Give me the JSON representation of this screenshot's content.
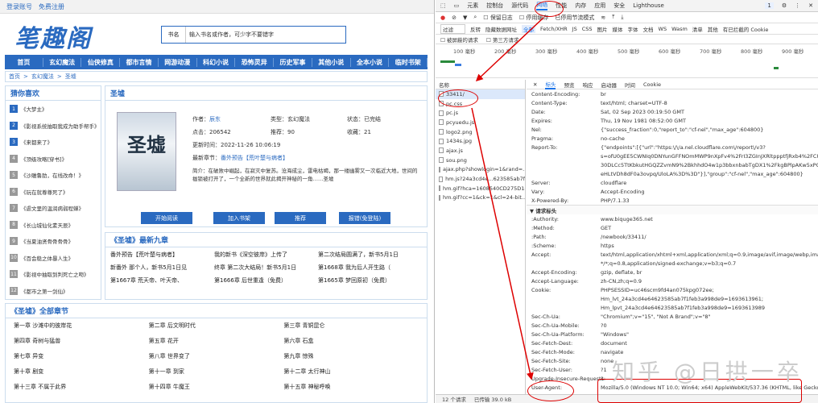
{
  "site": {
    "topbar": {
      "login": "登录账号",
      "register": "免费注册"
    },
    "logo": "笔趣阁",
    "search": {
      "select": "书名",
      "placeholder": "输入书名或作者，可少字不要错字"
    },
    "nav": [
      "首页",
      "玄幻魔法",
      "仙侠修真",
      "都市言情",
      "网游动漫",
      "科幻小说",
      "恐怖灵异",
      "历史军事",
      "其他小说",
      "全本小说",
      "临时书架"
    ],
    "breadcrumb": [
      "首页",
      "玄幻魔法",
      "圣墟"
    ],
    "rec_title": "猜你喜欢",
    "rec_items": [
      "《大梦主》",
      "《影视系统抽取我成为助手帮手》",
      "《来都来了》",
      "《顶级攻略[穿书]》",
      "《沙雕鲁肋，在线改命！》",
      "《玩在就尊尊死了》",
      "《虐文里的温润病弱程蝉》",
      "《长山城仙化素天辰》",
      "《当夏油贤骨骨骨骨》",
      "《百会稳之体暴人生》",
      "《影视中抽取到判死亡之吻》",
      "《都市之第一剑仙》"
    ],
    "book": {
      "title": "圣墟",
      "cover_title": "圣墟",
      "author_label": "作者：",
      "author": "辰东",
      "type_label": "类型：",
      "type": "玄幻魔法",
      "status_label": "状态：",
      "status": "已完结",
      "clicks_label": "点击：",
      "clicks": "206542",
      "recommend_label": "推荐：",
      "recommend": "90",
      "favorite_label": "收藏：",
      "favorite": "21",
      "update_label": "更新时间：",
      "update": "2022-11-26 10:06:19",
      "latest_label": "最新章节：",
      "latest": "番外预告【荒叶楚与病者】",
      "desc_label": "简介：",
      "desc": "在破败中崛起，在寂灭中复苏。沧海成尘，雷电枯竭，那一缕幽雾又一次临近大地，世间的枷锁被打开了，一个全新的世界就此揭开神秘的一角……圣墟",
      "buttons": [
        "开始阅读",
        "加入书架",
        "推荐",
        "报错(免登陆)"
      ]
    },
    "latest_title": "《圣墟》最新九章",
    "latest_chapters": [
      "番外预告【荒叶楚与病者】",
      "我的新书《深空彼岸》上传了",
      "第二次结局圆满了，新书5月1日",
      "新番外 那个人，新书5月1日见",
      "终章 第二次大结局！新书5月1日",
      "第1668章 我为后人开生路（",
      "第1667章 荒天帝、叶天帝、",
      "第1666章 后世重逢（免费）",
      "第1665章 梦回原初（免费）"
    ],
    "all_title": "《圣墟》全部章节",
    "all_chapters": [
      "第一章 沙滩中的彼岸花",
      "第二章 后文明时代",
      "第三章 青铜昆仑",
      "第四章 奇树与猛兽",
      "第五章 花开",
      "第六章 石盒",
      "第七章 异变",
      "第八章 世界变了",
      "第九章 惊殊",
      "第十章 剧变",
      "第十一章 到家",
      "第十二章 太行神山",
      "第十三章 不属于此界",
      "第十四章 牛魔王",
      "第十五章 神秘呼唤"
    ]
  },
  "devtools": {
    "tabs": [
      "元素",
      "控制台",
      "源代码",
      "网络",
      "性能",
      "内存",
      "应用",
      "安全",
      "Lighthouse"
    ],
    "active_tab": "网络",
    "badge": "1",
    "tools": [
      "保留日志",
      "停用缓存",
      "已停用节流模式"
    ],
    "filter_label": "过滤",
    "filter_options": [
      "反转",
      "隐藏数据网址",
      "全部",
      "Fetch/XHR",
      "JS",
      "CSS",
      "图片",
      "媒体",
      "字体",
      "文档",
      "WS",
      "Wasm",
      "清单",
      "其他",
      "有已拦截的 Cookie"
    ],
    "filter2": [
      "被屏蔽的请求",
      "第三方请求"
    ],
    "timeline_ticks": [
      "100 毫秒",
      "200 毫秒",
      "300 毫秒",
      "400 毫秒",
      "500 毫秒",
      "600 毫秒",
      "700 毫秒",
      "800 毫秒",
      "900 毫秒"
    ],
    "req_header": "名称",
    "requests": [
      "33411/",
      "pc.css",
      "pc.js",
      "pcyuedu.js",
      "logo2.png",
      "1434s.jpg",
      "ajax.js",
      "sou.png",
      "ajax.php?showlogin=1&rand=...",
      "hm.js?24a3cd4e...623585ab7f",
      "hm.gif?hca=1608540CD275D18...",
      "hm.gif?cc=1&ck=1&cl=24-bit..."
    ],
    "detail_tabs": [
      "标头",
      "预览",
      "响应",
      "启动器",
      "时间",
      "Cookie"
    ],
    "response_headers": [
      [
        "Content-Encoding:",
        "br"
      ],
      [
        "Content-Type:",
        "text/html; charset=UTF-8"
      ],
      [
        "Date:",
        "Sat, 02 Sep 2023 00:19:50 GMT"
      ],
      [
        "Expires:",
        "Thu, 19 Nov 1981 08:52:00 GMT"
      ],
      [
        "Nel:",
        "{\"success_fraction\":0,\"report_to\":\"cf-nel\",\"max_age\":604800}"
      ],
      [
        "Pragma:",
        "no-cache"
      ],
      [
        "Report-To:",
        "{\"endpoints\":[{\"url\":\"https:\\/\\/a.nel.cloudflare.com\\/report\\/v3?"
      ],
      [
        "",
        "s=ofU0gEE5CWNIq0DNYunGFFNOmMWP9nXpFv4%2FrI3ZGInJXRltppptfjRxb4%2FCU5"
      ],
      [
        "",
        "30DLCc5TtKbkutHGQZZvmN9%2BkhhdO4w1p3bbxnbabTgDX1%2FkgBPlpAKw5xPG51veJ"
      ],
      [
        "",
        "eHLtVDh8dF0a3ovpq/UloLA%3D%3D\"}],\"group\":\"cf-nel\",\"max_age\":604800}"
      ],
      [
        "Server:",
        "cloudflare"
      ],
      [
        "Vary:",
        "Accept-Encoding"
      ],
      [
        "X-Powered-By:",
        "PHP/7.1.33"
      ]
    ],
    "request_section": "▼ 请求标头",
    "request_headers": [
      [
        ":Authority:",
        "www.biquge365.net"
      ],
      [
        ":Method:",
        "GET"
      ],
      [
        ":Path:",
        "/newbook/33411/"
      ],
      [
        ":Scheme:",
        "https"
      ],
      [
        "Accept:",
        "text/html,application/xhtml+xml,application/xml;q=0.9,image/avif,image/webp,image/apng,"
      ],
      [
        "",
        "*/*;q=0.8,application/signed-exchange;v=b3;q=0.7"
      ],
      [
        "Accept-Encoding:",
        "gzip, deflate, br"
      ],
      [
        "Accept-Language:",
        "zh-CN,zh;q=0.9"
      ],
      [
        "Cookie:",
        "PHPSESSID=uc46scm9fd4an075kpg072ee;"
      ],
      [
        "",
        "Hm_lvt_24a3cd4e64623585ab7f1feb3a998de9=1693613961;"
      ],
      [
        "",
        "Hm_lpvt_24a3cd4e64623585ab7f1feb3a998de9=1693613989"
      ],
      [
        "Sec-Ch-Ua:",
        "\"Chromium\";v=\"15\", \"Not A Brand\";v=\"8\""
      ],
      [
        "Sec-Ch-Ua-Mobile:",
        "?0"
      ],
      [
        "Sec-Ch-Ua-Platform:",
        "\"Windows\""
      ],
      [
        "Sec-Fetch-Dest:",
        "document"
      ],
      [
        "Sec-Fetch-Mode:",
        "navigate"
      ],
      [
        "Sec-Fetch-Site:",
        "none"
      ],
      [
        "Sec-Fetch-User:",
        "?1"
      ],
      [
        "Upgrade-Insecure-Requests:",
        "1"
      ],
      [
        "User-Agent:",
        "Mozilla/5.0 (Windows NT 10.0; Win64; x64) AppleWebKit/537.36 (KHTML, like Gecko)"
      ],
      [
        "",
        "Chrome/114.0.5735.289 Safari/537.36"
      ]
    ],
    "status": [
      "12 个请求",
      "已传输 39.0 kB"
    ],
    "watermark": "知乎 @日拱一卒"
  }
}
